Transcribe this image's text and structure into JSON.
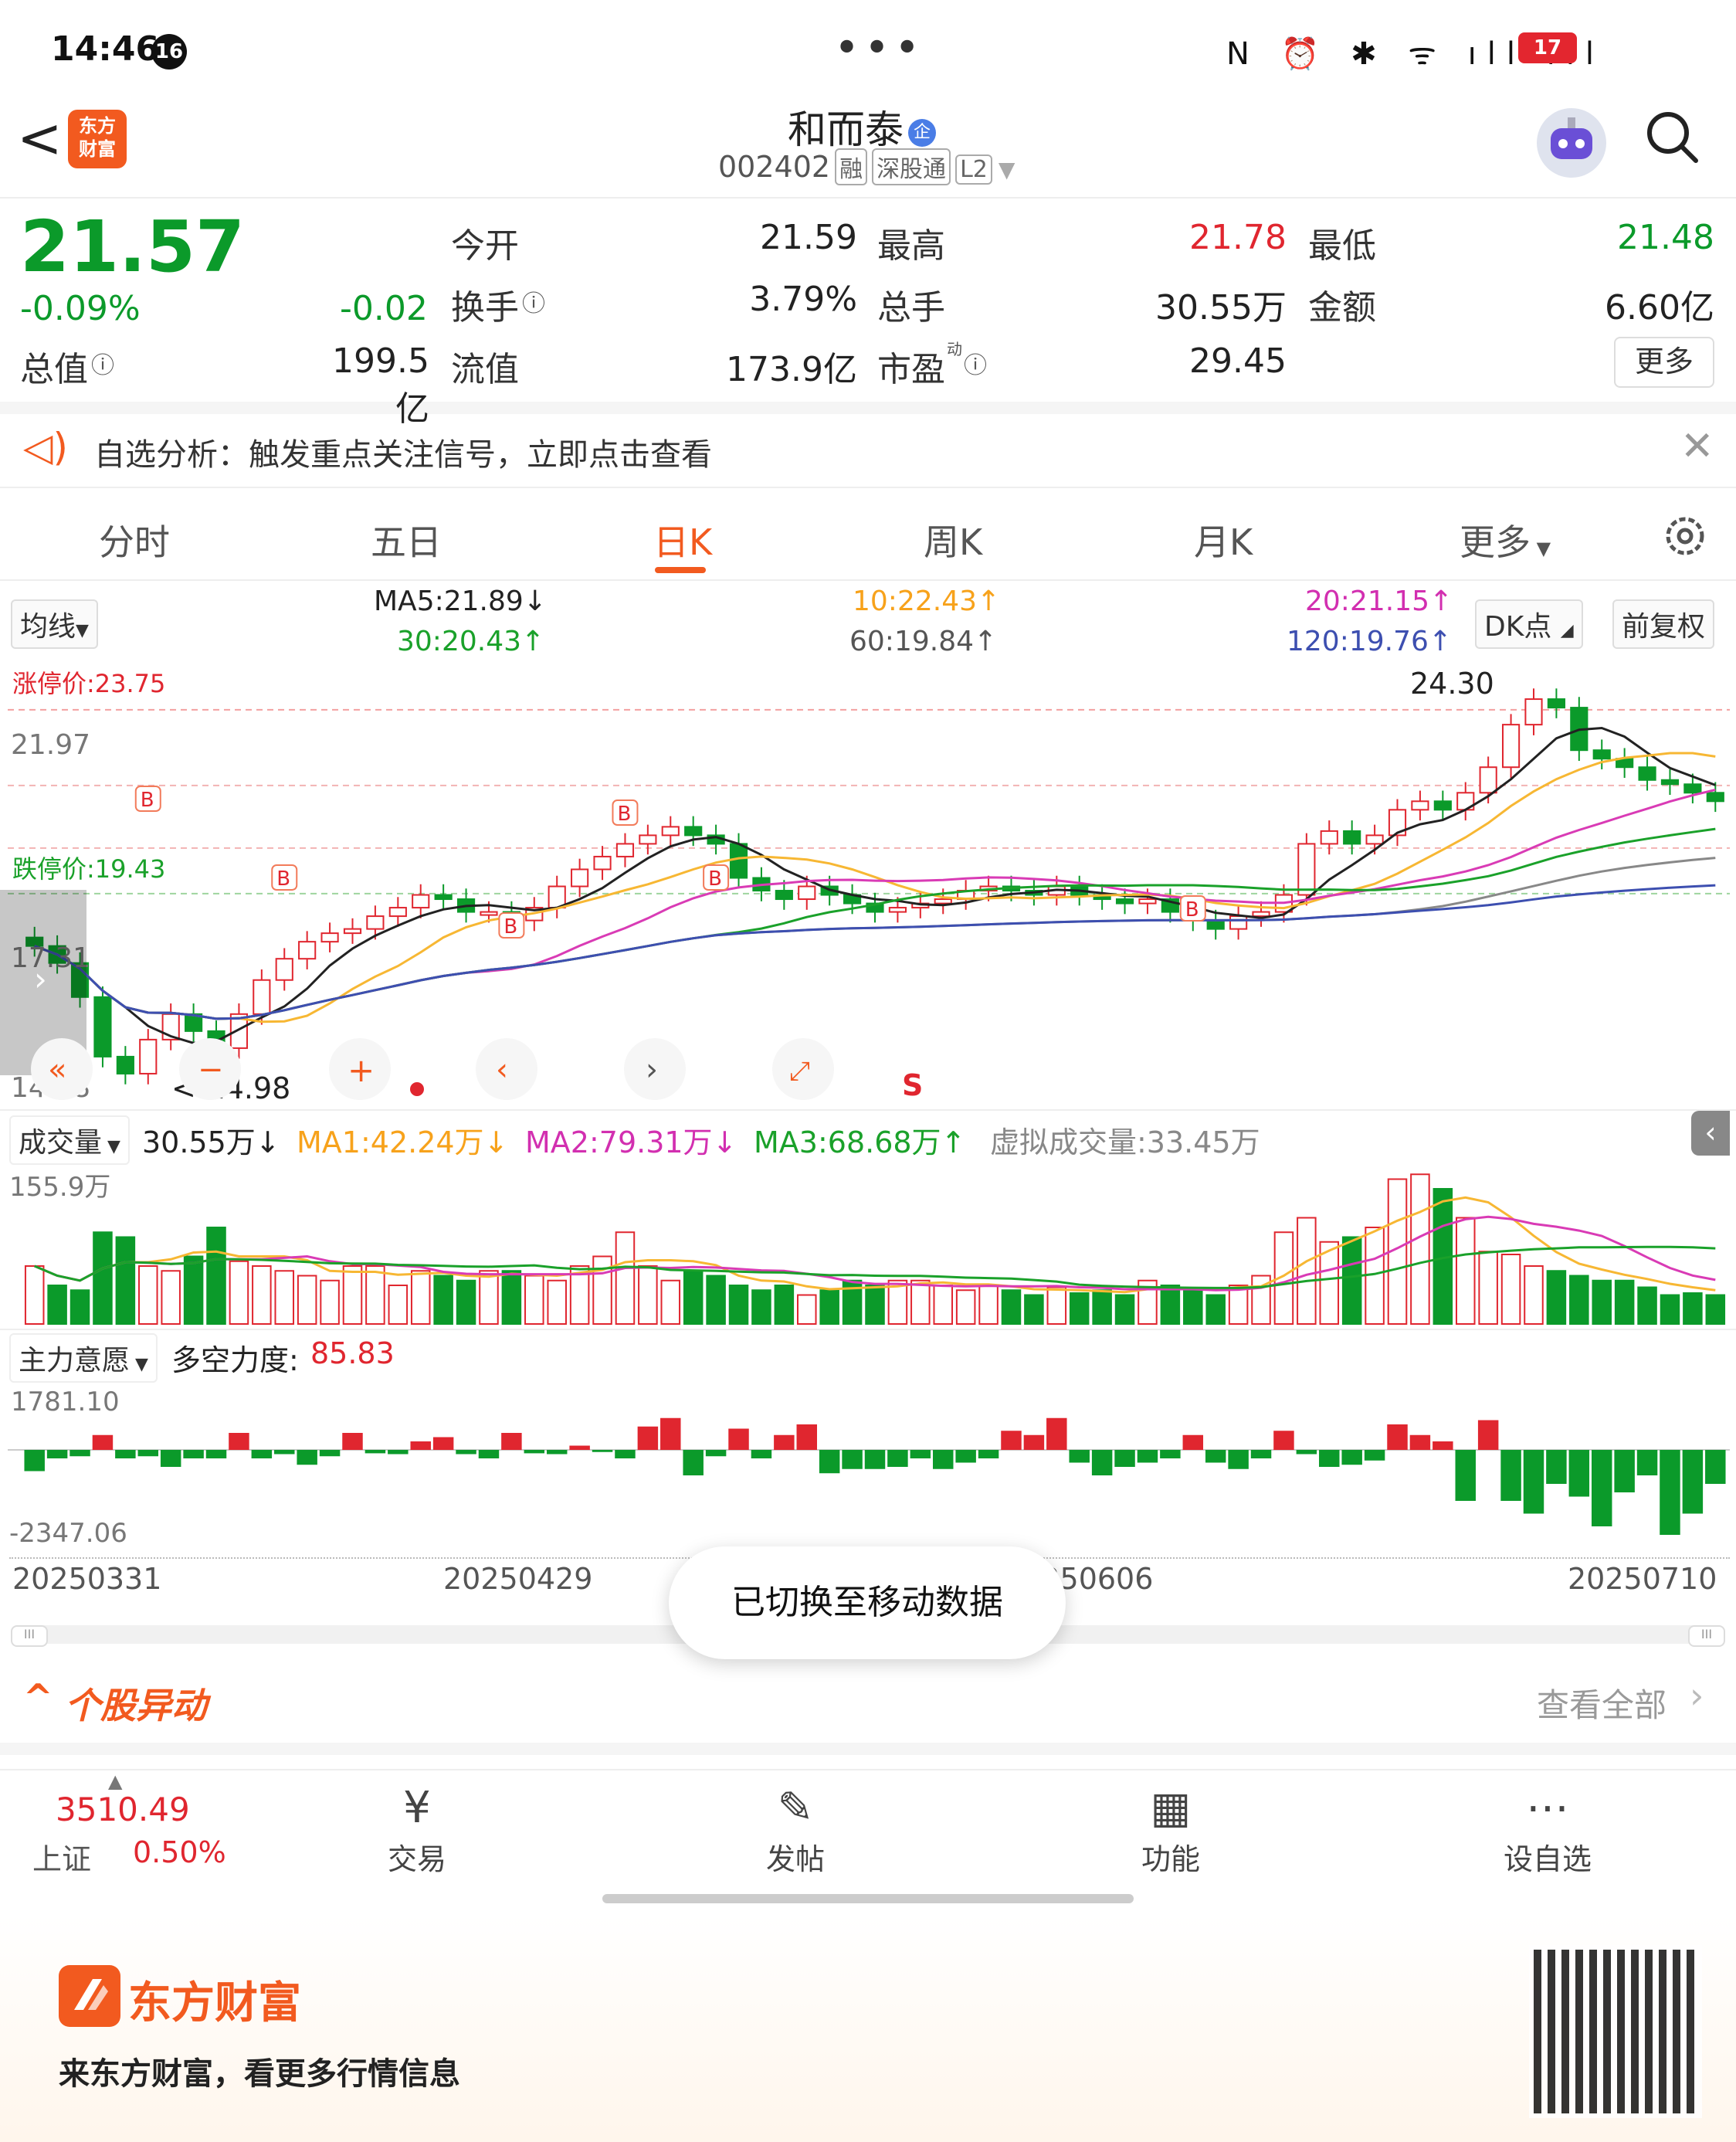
{
  "status_bar": {
    "time": "14:46",
    "notif_count": "16",
    "dots": "•••",
    "battery": "17"
  },
  "header": {
    "back": "<",
    "app_logo": "东方\n财富",
    "stock_name": "和而泰",
    "badge": "企",
    "code": "002402",
    "tags": [
      "融",
      "深股通",
      "L2"
    ]
  },
  "quote": {
    "price": "21.57",
    "change_pct": "-0.09%",
    "change": "-0.02",
    "fields": [
      {
        "label": "今开",
        "value": "21.59"
      },
      {
        "label": "最高",
        "value": "21.78",
        "color": "#e0262f"
      },
      {
        "label": "最低",
        "value": "21.48",
        "color": "#0b9a2a"
      },
      {
        "label": "换手",
        "value": "3.79%"
      },
      {
        "label": "总手",
        "value": "30.55万"
      },
      {
        "label": "金额",
        "value": "6.60亿"
      },
      {
        "label": "总值",
        "value": "199.5亿"
      },
      {
        "label": "流值",
        "value": "173.9亿"
      },
      {
        "label": "市盈",
        "value": "29.45"
      }
    ],
    "more": "更多"
  },
  "alert": {
    "text": "自选分析：触发重点关注信号，立即点击查看"
  },
  "tabs": [
    "分时",
    "五日",
    "日K",
    "周K",
    "月K",
    "更多"
  ],
  "active_tab": "日K",
  "ma_row": {
    "selector": "均线",
    "ma5": "MA5:21.89↓",
    "ma10": "10:22.43↑",
    "ma20": "20:21.15↑",
    "ma30": "30:20.43↑",
    "ma60": "60:19.84↑",
    "ma120": "120:19.76↑",
    "dk_button": "DK点",
    "fq_button": "前复权"
  },
  "kline": {
    "limit_up_label": "涨停价:23.75",
    "limit_down_label": "跌停价:19.43",
    "y_labels": [
      "21.97",
      "17.31",
      "14.98"
    ],
    "high_marker": "24.30",
    "low_marker": "<-14.98",
    "sell_marker": "S",
    "colors": {
      "up": "#e0262f",
      "down": "#0b9a2a",
      "ma5": "#222222",
      "ma10": "#f7b733",
      "ma20": "#d93bb5",
      "ma30": "#1aa12a",
      "ma60": "#888888",
      "ma120": "#3d4fb0"
    }
  },
  "volume": {
    "selector": "成交量",
    "value": "30.55万↓",
    "ma1": "MA1:42.24万↓",
    "ma2": "MA2:79.31万↓",
    "ma3": "MA3:68.68万↑",
    "virtual": "虚拟成交量:33.45万",
    "max_label": "155.9万"
  },
  "mainforce": {
    "selector": "主力意愿",
    "label": "多空力度:",
    "value": "85.83",
    "max_label": "1781.10",
    "min_label": "-2347.06"
  },
  "dates": [
    "20250331",
    "20250429",
    "20250606",
    "20250710"
  ],
  "toast": "已切换至移动数据",
  "movement": {
    "title": "个股异动",
    "link": "查看全部"
  },
  "bottom_nav": {
    "index_value": "3510.49",
    "index_name": "上证",
    "index_change": "0.50%",
    "items": [
      {
        "label": "交易",
        "icon": "trade-icon"
      },
      {
        "label": "发帖",
        "icon": "post-icon"
      },
      {
        "label": "功能",
        "icon": "grid-icon"
      },
      {
        "label": "设自选",
        "icon": "more-icon"
      }
    ]
  },
  "footer": {
    "brand": "东方财富",
    "slogan": "来东方财富，看更多行情信息"
  }
}
